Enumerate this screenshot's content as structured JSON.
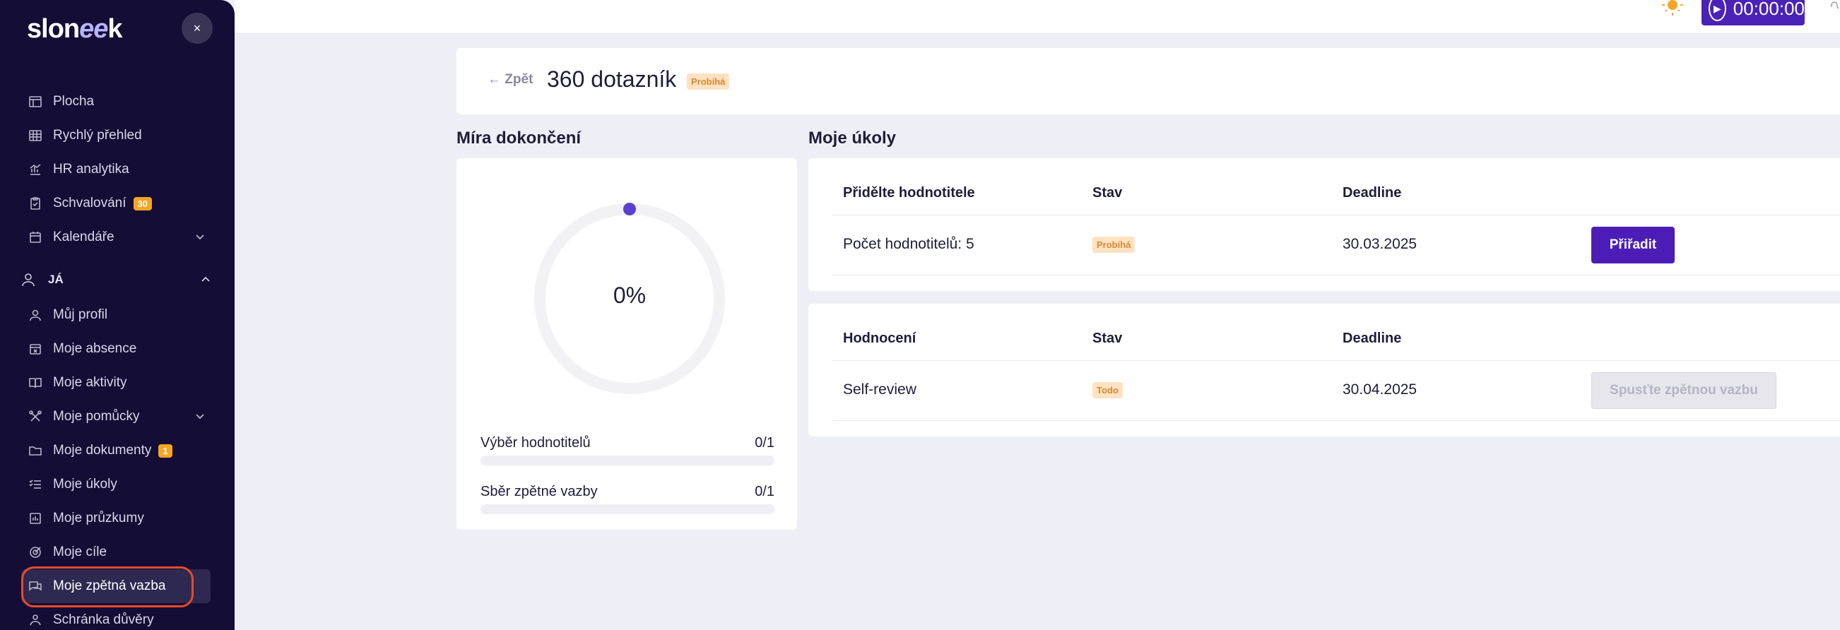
{
  "sidebar": {
    "logo": {
      "prefix": "slon",
      "mid": "ee",
      "suffix": "k"
    },
    "close_label": "×",
    "items": [
      {
        "label": "Plocha",
        "icon": "layout-icon"
      },
      {
        "label": "Rychlý přehled",
        "icon": "grid-icon"
      },
      {
        "label": "HR analytika",
        "icon": "chart-icon"
      },
      {
        "label": "Schvalování",
        "icon": "clipboard-icon",
        "badge": "30"
      },
      {
        "label": "Kalendáře",
        "icon": "calendar-icon"
      }
    ],
    "section": {
      "label": "JÁ",
      "icon": "user-icon"
    },
    "section_items": [
      {
        "label": "Můj profil",
        "icon": "user-icon"
      },
      {
        "label": "Moje absence",
        "icon": "calendar-x-icon"
      },
      {
        "label": "Moje aktivity",
        "icon": "book-icon"
      },
      {
        "label": "Moje pomůcky",
        "icon": "tools-icon"
      },
      {
        "label": "Moje dokumenty",
        "icon": "folder-icon",
        "badge": "1"
      },
      {
        "label": "Moje úkoly",
        "icon": "list-icon"
      },
      {
        "label": "Moje průzkumy",
        "icon": "survey-icon"
      },
      {
        "label": "Moje cíle",
        "icon": "target-icon"
      },
      {
        "label": "Moje zpětná vazba",
        "icon": "chat-icon",
        "active": true
      },
      {
        "label": "Schránka důvěry",
        "icon": "trust-icon"
      }
    ]
  },
  "topbar": {
    "timer": "00:00:00"
  },
  "header": {
    "back_label": "← Zpět",
    "title": "360 dotazník",
    "status": "Probíhá"
  },
  "progress": {
    "title": "Míra dokončení",
    "percent_label": "0%",
    "percent": 0,
    "rows": [
      {
        "label": "Výběr hodnotitelů",
        "value": "0/1",
        "fraction": 0
      },
      {
        "label": "Sběr zpětné vazby",
        "value": "0/1",
        "fraction": 0
      }
    ]
  },
  "tasks": {
    "title": "Moje úkoly",
    "assign": {
      "headers": [
        "Přidělte hodnotitele",
        "Stav",
        "Deadline"
      ],
      "row": {
        "name": "Počet hodnotitelů: 5",
        "status": "Probíhá",
        "deadline": "30.03.2025"
      },
      "button": "Přiřadit"
    },
    "review": {
      "headers": [
        "Hodnocení",
        "Stav",
        "Deadline"
      ],
      "row": {
        "name": "Self-review",
        "status": "Todo",
        "deadline": "30.04.2025"
      },
      "button": "Spusťte zpětnou vazbu"
    }
  },
  "colors": {
    "sidebar_bg": "#140d35",
    "accent": "#4b1db6",
    "status_bg": "#ffe2c2",
    "status_text": "#d48836",
    "highlight": "#e84a2b"
  }
}
